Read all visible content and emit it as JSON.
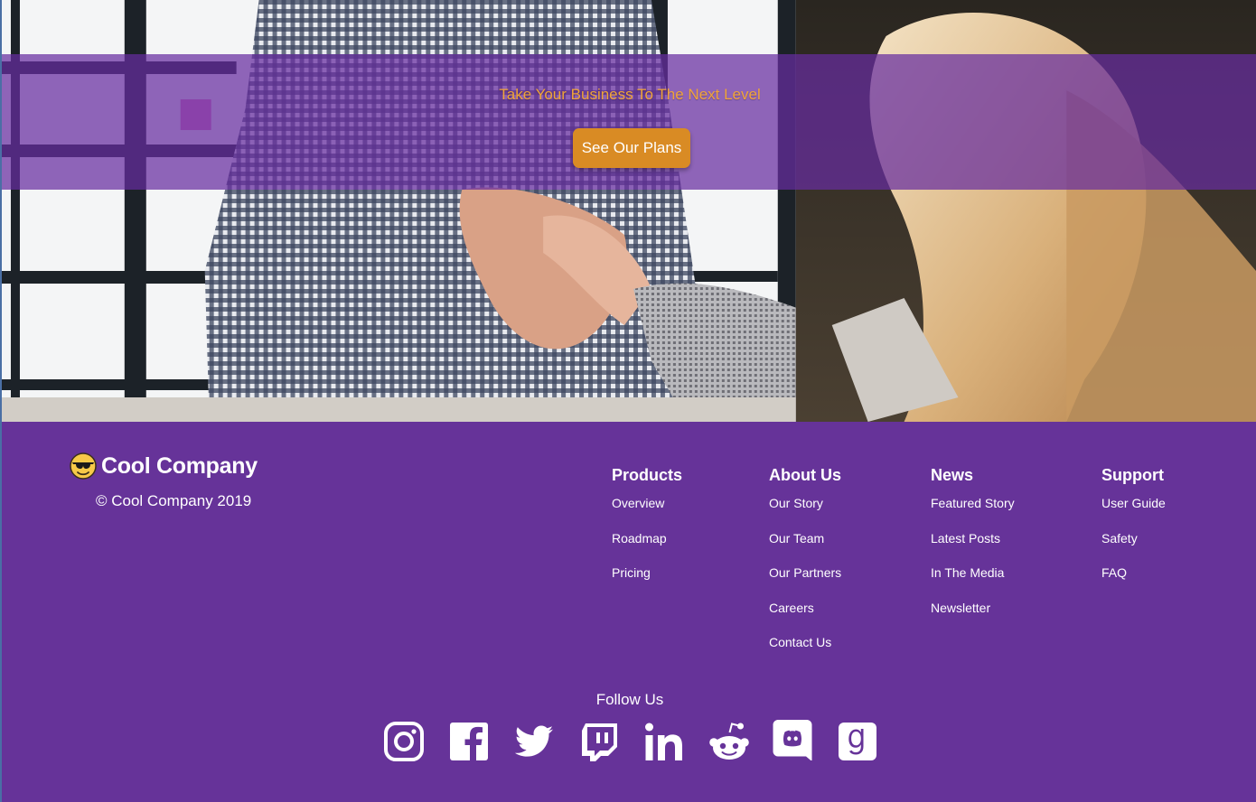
{
  "hero": {
    "tagline": "Take Your Business To The Next Level",
    "cta_label": "See Our Plans"
  },
  "brand": {
    "name": "Cool Company",
    "copyright": "© Cool Company 2019",
    "icon": "sunglasses-emoji-icon"
  },
  "footer": {
    "columns": [
      {
        "title": "Products",
        "links": [
          "Overview",
          "Roadmap",
          "Pricing"
        ]
      },
      {
        "title": "About Us",
        "links": [
          "Our Story",
          "Our Team",
          "Our Partners",
          "Careers",
          "Contact Us"
        ]
      },
      {
        "title": "News",
        "links": [
          "Featured Story",
          "Latest Posts",
          "In The Media",
          "Newsletter"
        ]
      },
      {
        "title": "Support",
        "links": [
          "User Guide",
          "Safety",
          "FAQ"
        ]
      }
    ],
    "follow_label": "Follow Us",
    "socials": [
      "instagram-icon",
      "facebook-icon",
      "twitter-icon",
      "twitch-icon",
      "linkedin-icon",
      "reddit-icon",
      "discord-icon",
      "goodreads-icon"
    ]
  },
  "colors": {
    "footer_bg": "#663399",
    "band": "#672ca0",
    "cta": "#d98b24",
    "tagline": "#f0a43a"
  }
}
